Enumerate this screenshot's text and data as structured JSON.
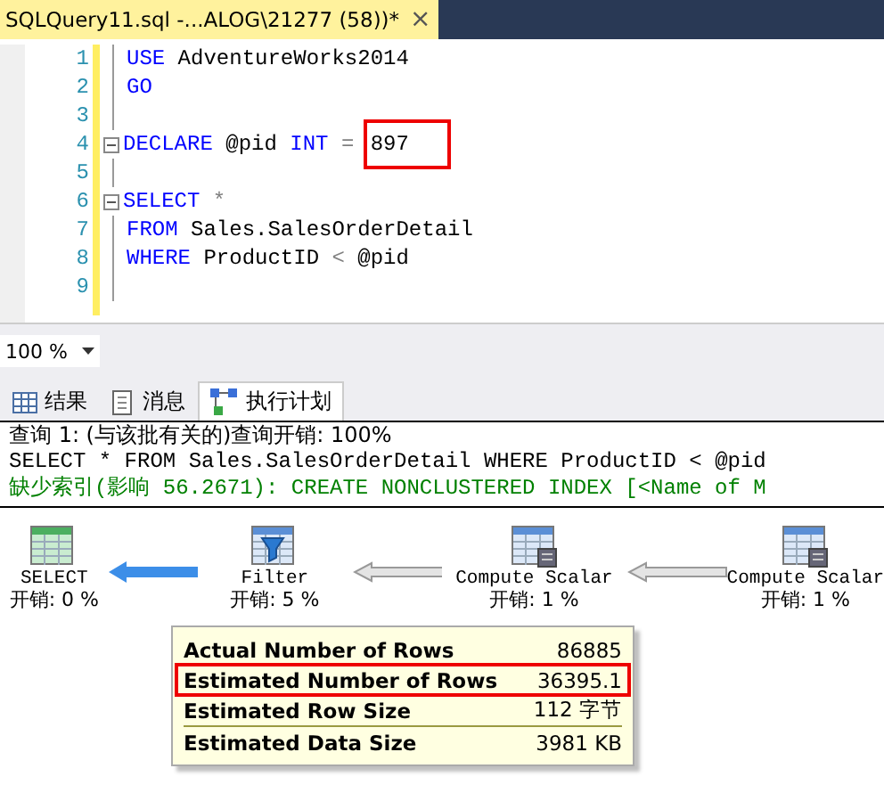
{
  "document_tab": {
    "title": "SQLQuery11.sql -...ALOG\\21277 (58))*",
    "close": "×"
  },
  "editor": {
    "lines": [
      {
        "number": "1",
        "fold": false,
        "tokens": [
          {
            "kind": "keyword",
            "text": "USE"
          },
          {
            "kind": "text",
            "text": " AdventureWorks2014"
          }
        ]
      },
      {
        "number": "2",
        "fold": false,
        "tokens": [
          {
            "kind": "keyword",
            "text": "GO"
          }
        ]
      },
      {
        "number": "3",
        "fold": false
      },
      {
        "number": "4",
        "fold": true,
        "tokens": [
          {
            "kind": "keyword",
            "text": "DECLARE"
          },
          {
            "kind": "text",
            "text": " @pid "
          },
          {
            "kind": "keyword",
            "text": "INT"
          },
          {
            "kind": "operator",
            "text": " = "
          },
          {
            "kind": "text",
            "text": "897",
            "highlighted": true
          }
        ]
      },
      {
        "number": "5",
        "fold": false
      },
      {
        "number": "6",
        "fold": true,
        "tokens": [
          {
            "kind": "keyword",
            "text": "SELECT"
          },
          {
            "kind": "operator",
            "text": " *"
          }
        ]
      },
      {
        "number": "7",
        "fold": false,
        "tokens": [
          {
            "kind": "keyword",
            "text": "FROM"
          },
          {
            "kind": "text",
            "text": " Sales.SalesOrderDetail"
          }
        ]
      },
      {
        "number": "8",
        "fold": false,
        "tokens": [
          {
            "kind": "keyword",
            "text": "WHERE"
          },
          {
            "kind": "text",
            "text": " ProductID "
          },
          {
            "kind": "operator",
            "text": "<"
          },
          {
            "kind": "text",
            "text": " @pid"
          }
        ]
      },
      {
        "number": "9",
        "fold": false
      }
    ]
  },
  "zoom": {
    "value": "100 %"
  },
  "result_tabs": [
    {
      "label": "结果",
      "selected": false
    },
    {
      "label": "消息",
      "selected": false
    },
    {
      "label": "执行计划",
      "selected": true
    }
  ],
  "messages": [
    {
      "kind": "plain",
      "text": "查询 1: (与该批有关的)查询开销: 100%"
    },
    {
      "kind": "code",
      "text": "SELECT * FROM Sales.SalesOrderDetail WHERE ProductID < @pid"
    },
    {
      "kind": "hint",
      "text": "缺少索引(影响 56.2671): CREATE NONCLUSTERED INDEX [<Name of M"
    }
  ],
  "plan": {
    "nodes": [
      {
        "kind": "select",
        "label": "SELECT",
        "cost": "开销: 0 %"
      },
      {
        "kind": "filter",
        "label": "Filter",
        "cost": "开销: 5 %"
      },
      {
        "kind": "compute",
        "label": "Compute Scalar",
        "cost": "开销: 1 %"
      },
      {
        "kind": "compute",
        "label": "Compute Scalar",
        "cost": "开销: 1 %"
      }
    ],
    "arrows": [
      {
        "selected": true
      },
      {
        "selected": false
      },
      {
        "selected": false
      }
    ]
  },
  "tooltip": {
    "sections": [
      [
        {
          "label": "Actual Number of Rows",
          "value": "86885",
          "highlighted": false
        },
        {
          "label": "Estimated Number of Rows",
          "value": "36395.1",
          "highlighted": true
        },
        {
          "label": "Estimated Row Size",
          "value": "112 字节",
          "highlighted": false
        }
      ],
      [
        {
          "label": "Estimated Data Size",
          "value": "3981 KB",
          "highlighted": false
        }
      ]
    ]
  }
}
